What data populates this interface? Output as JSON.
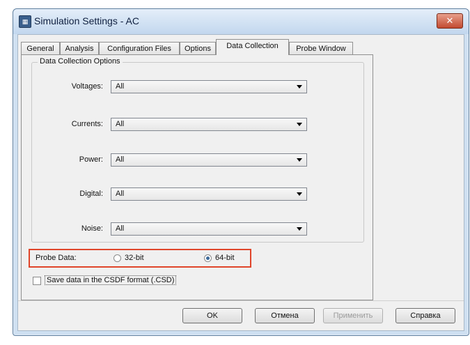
{
  "window": {
    "title": "Simulation Settings - AC",
    "close_label": "✕"
  },
  "tabs": [
    {
      "label": "General"
    },
    {
      "label": "Analysis"
    },
    {
      "label": "Configuration Files"
    },
    {
      "label": "Options"
    },
    {
      "label": "Data Collection",
      "active": true
    },
    {
      "label": "Probe Window"
    }
  ],
  "data_collection": {
    "group_title": "Data Collection Options",
    "fields": [
      {
        "label": "Voltages:",
        "value": "All"
      },
      {
        "label": "Currents:",
        "value": "All"
      },
      {
        "label": "Power:",
        "value": "All"
      },
      {
        "label": "Digital:",
        "value": "All"
      },
      {
        "label": "Noise:",
        "value": "All"
      }
    ]
  },
  "probe_data": {
    "label": "Probe Data:",
    "options": [
      {
        "label": "32-bit",
        "checked": false
      },
      {
        "label": "64-bit",
        "checked": true
      }
    ]
  },
  "save_csdf": {
    "label": "Save data in the CSDF format (.CSD)",
    "checked": false
  },
  "buttons": {
    "ok": "OK",
    "cancel": "Отмена",
    "apply": "Применить",
    "help": "Справка"
  },
  "colors": {
    "highlight": "#e0452a"
  }
}
